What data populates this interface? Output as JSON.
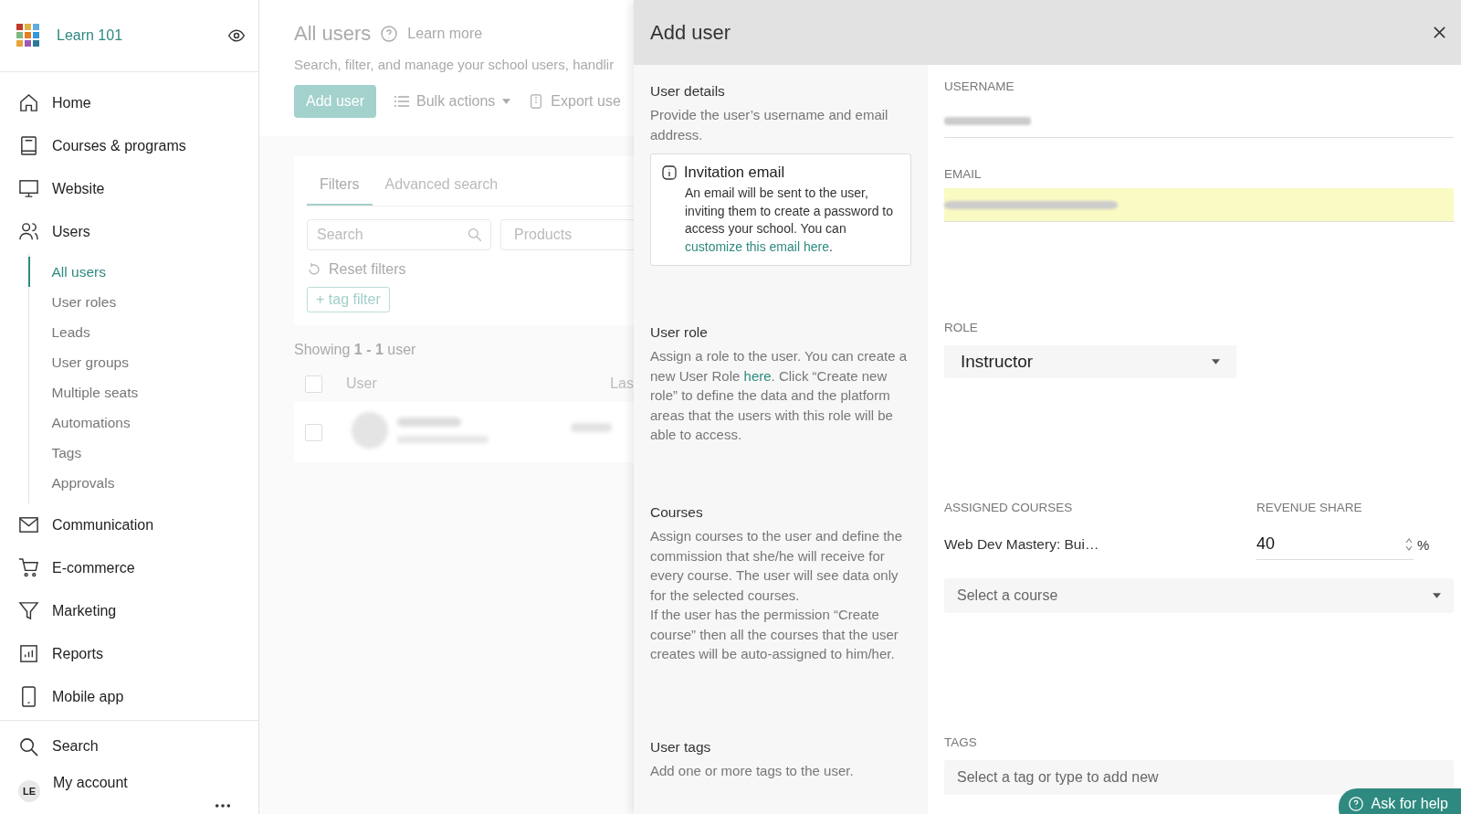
{
  "sidebar": {
    "brand": "Learn 101",
    "items": [
      {
        "label": "Home"
      },
      {
        "label": "Courses & programs"
      },
      {
        "label": "Website"
      },
      {
        "label": "Users",
        "children": [
          {
            "label": "All users",
            "selected": true
          },
          {
            "label": "User roles",
            "selected": false
          },
          {
            "label": "Leads",
            "selected": false
          },
          {
            "label": "User groups",
            "selected": false
          },
          {
            "label": "Multiple seats",
            "selected": false
          },
          {
            "label": "Automations",
            "selected": false
          },
          {
            "label": "Tags",
            "selected": false
          },
          {
            "label": "Approvals",
            "selected": false
          }
        ]
      },
      {
        "label": "Communication"
      },
      {
        "label": "E-commerce"
      },
      {
        "label": "Marketing"
      },
      {
        "label": "Reports"
      },
      {
        "label": "Mobile app"
      }
    ],
    "bottom": [
      {
        "label": "Search"
      },
      {
        "label": "My account",
        "initials": "LE"
      }
    ]
  },
  "main": {
    "title": "All users",
    "learn_more": "Learn more",
    "subtitle": "Search, filter, and manage your school users, handlir",
    "toolbar": {
      "add": "Add user",
      "bulk": "Bulk actions",
      "export": "Export use"
    },
    "tabs": [
      {
        "label": "Filters",
        "selected": true
      },
      {
        "label": "Advanced search",
        "selected": false
      }
    ],
    "search": {
      "placeholder": "Search"
    },
    "products": {
      "placeholder": "Products"
    },
    "reset": "Reset filters",
    "tag_filter": "+ tag filter",
    "showing": "Showing **1 - 1** user",
    "table": {
      "columns": [
        "User",
        "Las"
      ],
      "all_checked": false,
      "rows": [
        {
          "checked": false
        }
      ]
    }
  },
  "panel": {
    "title": "Add user",
    "sections": [
      {
        "title": "User details",
        "text": "Provide the user’s username and email address.",
        "kind": "details",
        "info": {
          "title": "Invitation email",
          "text": "An email will be sent to the user, inviting them to create a password to access your school. You can ",
          "link": "customize this email here",
          "after": "."
        },
        "fields": [
          {
            "label": "USERNAME",
            "highlight": false
          },
          {
            "label": "EMAIL",
            "highlight": true
          }
        ]
      },
      {
        "title": "User role",
        "text_before": "Assign a role to the user. You can create a new User Role ",
        "link": "here",
        "text_after": ". Click “Create new role” to define the data and the platform areas that the users with this role will be able to access.",
        "kind": "role",
        "label": "ROLE",
        "value": "Instructor"
      },
      {
        "title": "Courses",
        "text": "Assign courses to the user and define the commission that she/he will receive for every course. The user will see data only for the selected courses.",
        "text2": "If the user has the permission “Create course” then all the courses that the user creates will be auto-assigned to him/her.",
        "kind": "courses",
        "label": "ASSIGNED COURSES",
        "share_label": "REVENUE SHARE",
        "courses": [
          {
            "name": "Web Dev Mastery: Bui…",
            "share": "40",
            "unit": "%"
          }
        ],
        "select": {
          "placeholder": "Select a course"
        }
      },
      {
        "title": "User tags",
        "text": "Add one or more tags to the user.",
        "kind": "tags",
        "label": "TAGS",
        "select": {
          "placeholder": "Select a tag or type to add new"
        }
      }
    ]
  },
  "help": "Ask for help"
}
